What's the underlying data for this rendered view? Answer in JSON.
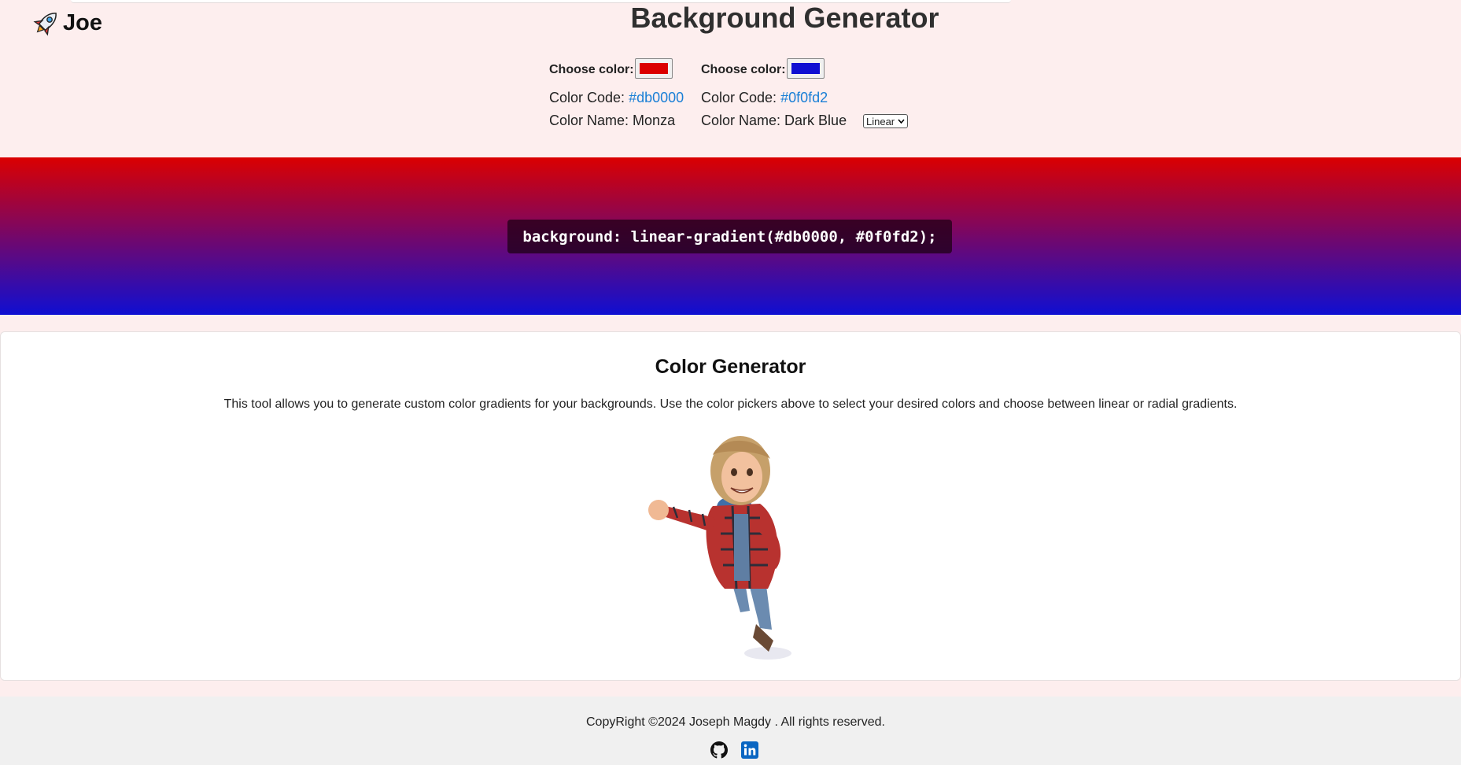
{
  "brand": {
    "name": "Joe",
    "icon": "rocket-icon"
  },
  "header": {
    "title": "Background Generator"
  },
  "color1": {
    "pick_label": "Choose color:",
    "code_label": "Color Code:",
    "code": "#db0000",
    "name_label": "Color Name:",
    "name": "Monza",
    "swatch": "#db0000"
  },
  "color2": {
    "pick_label": "Choose color:",
    "code_label": "Color Code:",
    "code": "#0f0fd2",
    "name_label": "Color Name:",
    "name": "Dark Blue",
    "swatch": "#0f0fd2"
  },
  "gradient_type": {
    "selected": "Linear"
  },
  "output": {
    "css": "background: linear-gradient(#db0000, #0f0fd2);"
  },
  "info": {
    "title": "Color Generator",
    "description": "This tool allows you to generate custom color gradients for your backgrounds. Use the color pickers above to select your desired colors and choose between linear or radial gradients."
  },
  "footer": {
    "copyright": "CopyRight ©2024 Joseph Magdy . All rights reserved.",
    "icons": [
      "github-icon",
      "linkedin-icon"
    ]
  },
  "colors": {
    "link": "#1a7fd6",
    "page_bg": "#fdeeee",
    "linkedin": "#0a66c2"
  }
}
